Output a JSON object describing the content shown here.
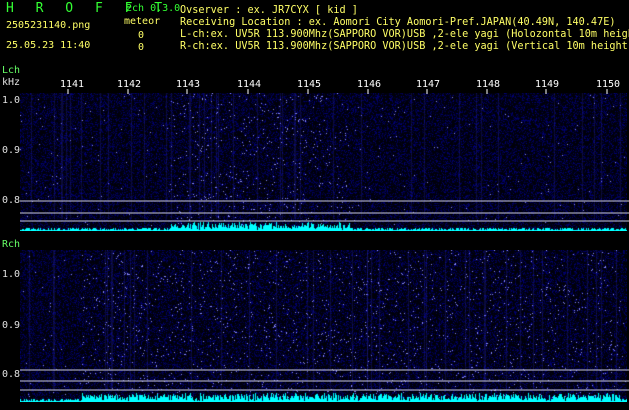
{
  "header": {
    "brand": "H R O F F T",
    "version": "2ch 0.3.0",
    "meteor_label": "meteor",
    "filename": "2505231140.png",
    "timestamp": "25.05.23 11:40",
    "count_l": "0",
    "count_r": "0"
  },
  "info": {
    "observer": "Ovserver           : ex. JR7CYX [ kid ]",
    "location": "Receiving Location : ex. Aomori City Aomori-Pref.JAPAN(40.49N, 140.47E)",
    "lch": "L-ch:ex. UV5R 113.900Mhz(SAPPORO VOR)USB ,2-ele yagi (Holozontal 10m height)",
    "rch": "R-ch:ex. UV5R 113.900Mhz(SAPPORO VOR)USB ,2-ele yagi (Vertical 10m height)"
  },
  "lch_panel": {
    "label": "Lch",
    "unit": "kHz",
    "yticks": [
      "1.0",
      "0.9",
      "0.8"
    ]
  },
  "rch_panel": {
    "label": "Rch",
    "yticks": [
      "1.0",
      "0.9",
      "0.8"
    ]
  },
  "freq_ticks": [
    "1141",
    "1142",
    "1143",
    "1144",
    "1145",
    "1146",
    "1147",
    "1148",
    "1149",
    "1150"
  ],
  "colors": {
    "background": "#000000",
    "brand": "#33ff33",
    "text": "#ffff66",
    "trace": "#00ffff",
    "noise": "#1a1aa0",
    "gridline": "#c8c8dc"
  }
}
